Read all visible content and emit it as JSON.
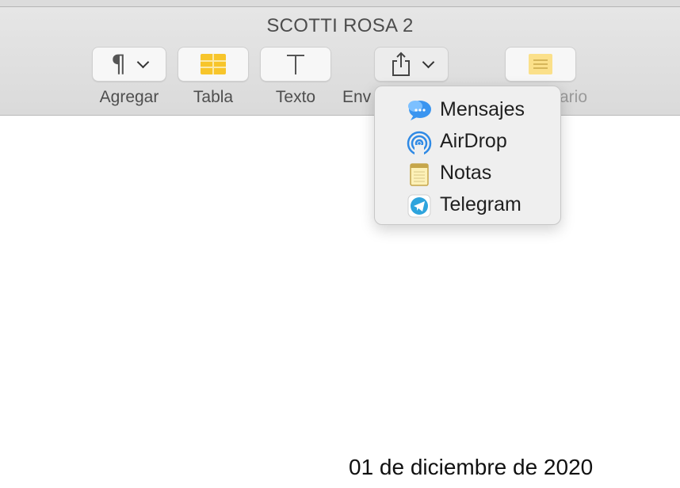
{
  "window": {
    "title": "SCOTTI ROSA 2"
  },
  "toolbar": {
    "buttons": [
      {
        "label": "Agregar",
        "icon": "paragraph-icon"
      },
      {
        "label": "Tabla",
        "icon": "table-icon"
      },
      {
        "label": "Texto",
        "icon": "text-icon"
      },
      {
        "label": "Env",
        "icon": "share-icon"
      },
      {
        "label": "ario",
        "icon": "note-icon"
      }
    ]
  },
  "share_menu": {
    "items": [
      {
        "label": "Mensajes",
        "icon": "messages-icon"
      },
      {
        "label": "AirDrop",
        "icon": "airdrop-icon"
      },
      {
        "label": "Notas",
        "icon": "notes-icon"
      },
      {
        "label": "Telegram",
        "icon": "telegram-icon"
      }
    ]
  },
  "document": {
    "date": "01 de diciembre de 2020"
  },
  "colors": {
    "toolbar_bg": "#dedede",
    "table_yellow": "#f7c52b",
    "menu_bg": "#efefef",
    "messages_blue": "#3a95f0",
    "telegram_blue": "#2ea4dd"
  }
}
